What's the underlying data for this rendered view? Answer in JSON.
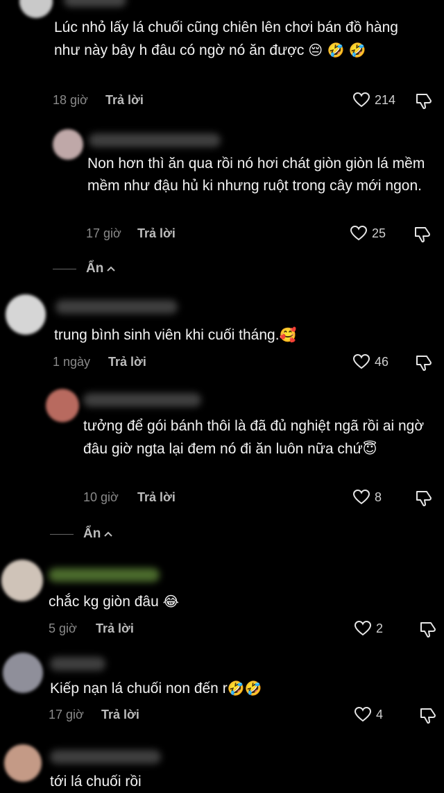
{
  "comments": [
    {
      "text": "Lúc nhỏ lấy lá chuối cũng chiên lên chơi bán đồ hàng như này bây h đâu có ngờ nó ăn được",
      "emoji": "😔 🤣 🤣",
      "time": "18 giờ",
      "reply": "Trả lời",
      "likes": "214"
    },
    {
      "text": "Non hơn thì ăn qua rồi nó hơi chát giòn giòn lá mềm mềm như đậu hủ ki nhưng ruột trong cây mới ngon.",
      "time": "17 giờ",
      "reply": "Trả lời",
      "likes": "25"
    },
    {
      "text": "trung bình sinh viên khi cuối tháng.",
      "emoji": "🥰",
      "time": "1 ngày",
      "reply": "Trả lời",
      "likes": "46"
    },
    {
      "text": "tưởng để gói bánh thôi là đã đủ nghiệt ngã rồi ai ngờ đâu giờ ngta lại đem nó đi ăn luôn nữa chứ",
      "emoji": "😇",
      "time": "10 giờ",
      "reply": "Trả lời",
      "likes": "8"
    },
    {
      "text": "chắc kg giòn đâu",
      "emoji": "😂",
      "time": "5 giờ",
      "reply": "Trả lời",
      "likes": "2"
    },
    {
      "text": "Kiếp nạn lá chuối non đến r",
      "emoji": "🤣🤣",
      "time": "17 giờ",
      "reply": "Trả lời",
      "likes": "4"
    },
    {
      "text": "tới lá chuối rồi"
    }
  ],
  "hide_label": "Ẩn",
  "icons": {
    "like": "heart-outline-icon",
    "dislike": "thumbs-down-icon",
    "hide": "chevron-up-icon"
  },
  "colors": {
    "background": "#000000",
    "text": "#f2f2f2",
    "meta": "#8a8a8a"
  }
}
